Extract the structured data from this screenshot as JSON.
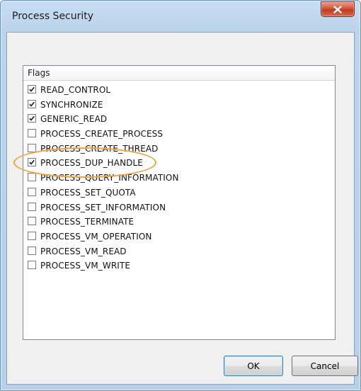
{
  "window": {
    "title": "Process Security"
  },
  "list": {
    "column_header": "Flags",
    "items": [
      {
        "label": "READ_CONTROL",
        "checked": true
      },
      {
        "label": "SYNCHRONIZE",
        "checked": true
      },
      {
        "label": "GENERIC_READ",
        "checked": true
      },
      {
        "label": "PROCESS_CREATE_PROCESS",
        "checked": false
      },
      {
        "label": "PROCESS_CREATE_THREAD",
        "checked": false
      },
      {
        "label": "PROCESS_DUP_HANDLE",
        "checked": true,
        "highlighted": true
      },
      {
        "label": "PROCESS_QUERY_INFORMATION",
        "checked": false
      },
      {
        "label": "PROCESS_SET_QUOTA",
        "checked": false
      },
      {
        "label": "PROCESS_SET_INFORMATION",
        "checked": false
      },
      {
        "label": "PROCESS_TERMINATE",
        "checked": false
      },
      {
        "label": "PROCESS_VM_OPERATION",
        "checked": false
      },
      {
        "label": "PROCESS_VM_READ",
        "checked": false
      },
      {
        "label": "PROCESS_VM_WRITE",
        "checked": false
      }
    ]
  },
  "buttons": {
    "ok_label": "OK",
    "cancel_label": "Cancel"
  },
  "colors": {
    "highlight_ring": "#f0a440",
    "close_button": "#c13a20"
  },
  "icons": {
    "close": "close-icon",
    "check": "checkmark-icon"
  }
}
